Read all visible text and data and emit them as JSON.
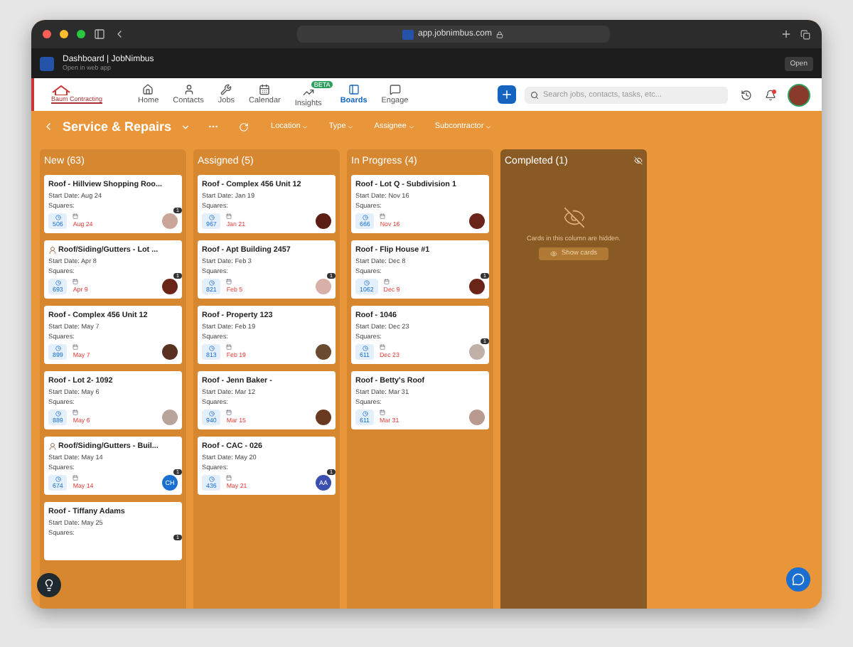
{
  "browser": {
    "url": "app.jobnimbus.com"
  },
  "banner": {
    "title": "Dashboard | JobNimbus",
    "subtitle": "Open in web app",
    "button": "Open"
  },
  "nav": {
    "logo": "Baum Contracting",
    "items": [
      {
        "label": "Home",
        "selected": false
      },
      {
        "label": "Contacts",
        "selected": false
      },
      {
        "label": "Jobs",
        "selected": false
      },
      {
        "label": "Calendar",
        "selected": false
      },
      {
        "label": "Insights",
        "selected": false,
        "badge": "BETA"
      },
      {
        "label": "Boards",
        "selected": true
      },
      {
        "label": "Engage",
        "selected": false
      }
    ],
    "search": {
      "placeholder": "Search jobs, contacts, tasks, etc..."
    },
    "notifications_unread": true
  },
  "board": {
    "title": "Service & Repairs",
    "filters": [
      "Location",
      "Type",
      "Assignee",
      "Subcontractor"
    ]
  },
  "columns": [
    {
      "title": "New (63)",
      "kind": "cards",
      "cards": [
        {
          "title": "Roof - Hillview Shopping Roo...",
          "start": "Start Date: Aug 24",
          "squares": "Squares:",
          "number": "506",
          "date": "Aug 24",
          "count": "1",
          "avatar": {
            "kind": "photo",
            "color": "#c9a59a"
          }
        },
        {
          "title": "Roof/Siding/Gutters - Lot ...",
          "person_icon": true,
          "start": "Start Date: Apr 8",
          "squares": "Squares:",
          "number": "693",
          "date": "Apr 9",
          "count": "1",
          "avatar": {
            "kind": "photo",
            "color": "#6b2418"
          }
        },
        {
          "title": "Roof - Complex 456 Unit 12",
          "start": "Start Date: May 7",
          "squares": "Squares:",
          "number": "899",
          "date": "May 7",
          "avatar": {
            "kind": "photo",
            "color": "#5a3020"
          }
        },
        {
          "title": "Roof - Lot 2- 1092",
          "start": "Start Date: May 6",
          "squares": "Squares:",
          "number": "889",
          "date": "May 6",
          "avatar": {
            "kind": "photo",
            "color": "#b8a49a"
          }
        },
        {
          "title": "Roof/Siding/Gutters - Buil...",
          "person_icon": true,
          "start": "Start Date: May 14",
          "squares": "Squares:",
          "number": "674",
          "date": "May 14",
          "count": "1",
          "avatar": {
            "kind": "initials",
            "initials": "CH",
            "color": "#1a6fd1"
          }
        },
        {
          "title": "Roof - Tiffany Adams",
          "start": "Start Date: May 25",
          "squares": "Squares:",
          "count": "1"
        }
      ]
    },
    {
      "title": "Assigned (5)",
      "kind": "cards",
      "cards": [
        {
          "title": "Roof - Complex 456 Unit 12",
          "start": "Start Date: Jan 19",
          "squares": "Squares:",
          "number": "967",
          "date": "Jan 21",
          "avatar": {
            "kind": "photo",
            "color": "#5a1e14"
          }
        },
        {
          "title": "Roof - Apt Building 2457",
          "start": "Start Date: Feb 3",
          "squares": "Squares:",
          "number": "821",
          "date": "Feb 5",
          "count": "1",
          "avatar": {
            "kind": "photo",
            "color": "#d8b0a8"
          }
        },
        {
          "title": "Roof - Property 123",
          "start": "Start Date: Feb 19",
          "squares": "Squares:",
          "number": "813",
          "date": "Feb 19",
          "avatar": {
            "kind": "photo",
            "color": "#6a4a30"
          }
        },
        {
          "title": "Roof - Jenn Baker -",
          "start": "Start Date: Mar 12",
          "squares": "Squares:",
          "number": "940",
          "date": "Mar 15",
          "avatar": {
            "kind": "photo",
            "color": "#6a3a20"
          }
        },
        {
          "title": "Roof - CAC - 026",
          "start": "Start Date: May 20",
          "squares": "Squares:",
          "number": "436",
          "date": "May 21",
          "count": "1",
          "avatar": {
            "kind": "initials",
            "initials": "AA",
            "color": "#3a4fb0"
          }
        }
      ]
    },
    {
      "title": "In Progress (4)",
      "kind": "cards",
      "cards": [
        {
          "title": "Roof - Lot Q - Subdivision 1",
          "start": "Start Date: Nov 16",
          "squares": "Squares:",
          "number": "666",
          "date": "Nov 16",
          "avatar": {
            "kind": "photo",
            "color": "#6b2418"
          }
        },
        {
          "title": "Roof - Flip House #1",
          "start": "Start Date: Dec 8",
          "squares": "Squares:",
          "number": "1062",
          "date": "Dec 9",
          "count": "1",
          "avatar": {
            "kind": "photo",
            "color": "#6b2418"
          }
        },
        {
          "title": "Roof - 1046",
          "start": "Start Date: Dec 23",
          "squares": "Squares:",
          "number": "611",
          "date": "Dec 23",
          "count": "1",
          "avatar": {
            "kind": "photo",
            "color": "#c0b0a8"
          }
        },
        {
          "title": "Roof - Betty's Roof",
          "start": "Start Date: Mar 31",
          "squares": "Squares:",
          "number": "611",
          "date": "Mar 31",
          "avatar": {
            "kind": "photo",
            "color": "#b89a90"
          }
        }
      ]
    },
    {
      "title": "Completed (1)",
      "kind": "hidden",
      "message": "Cards in this column are hidden.",
      "button": "Show cards"
    }
  ]
}
